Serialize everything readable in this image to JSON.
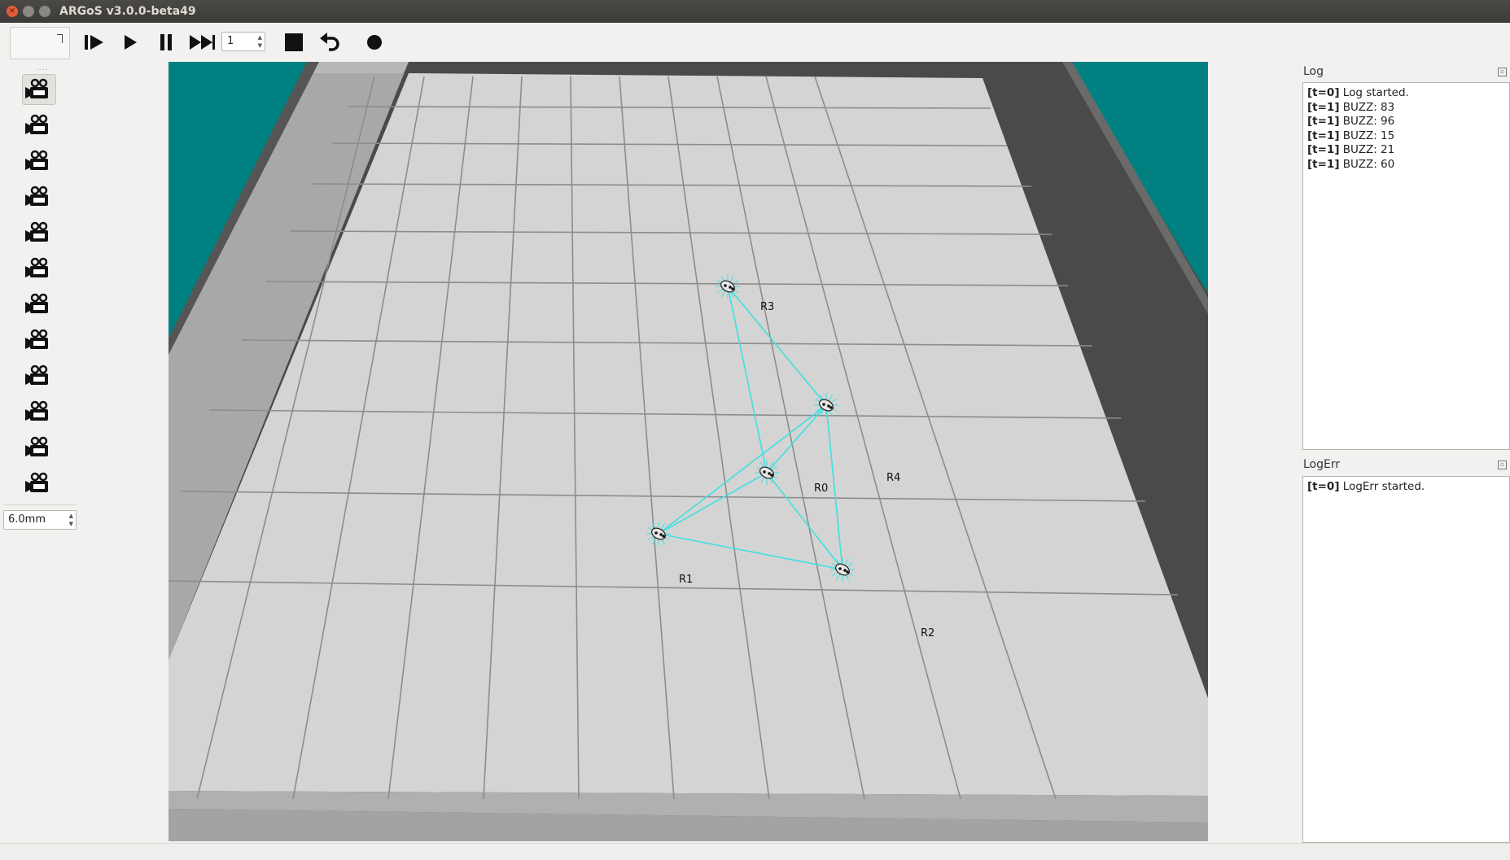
{
  "window": {
    "title": "ARGoS v3.0.0-beta49"
  },
  "toolbar": {
    "step_value": "1",
    "icons": [
      "step-icon",
      "play-icon",
      "pause-icon",
      "fast-forward-icon",
      "stop-icon",
      "reset-icon",
      "record-icon"
    ]
  },
  "left": {
    "camera_count": 12,
    "point_size": "6.0mm"
  },
  "arena": {
    "floor_color": "#d4d4d4",
    "wall_color": "#a9a9a9",
    "wall_dark_color": "#4a4a4a",
    "background_color": "#008080",
    "link_color": "#40e0e0",
    "robots": [
      {
        "label": "R0"
      },
      {
        "label": "R1"
      },
      {
        "label": "R2"
      },
      {
        "label": "R3"
      },
      {
        "label": "R4"
      }
    ]
  },
  "log": {
    "title": "Log",
    "entries": [
      {
        "tag": "[t=0]",
        "text": "Log started."
      },
      {
        "tag": "[t=1]",
        "text": "BUZZ: 83"
      },
      {
        "tag": "[t=1]",
        "text": "BUZZ: 96"
      },
      {
        "tag": "[t=1]",
        "text": "BUZZ: 15"
      },
      {
        "tag": "[t=1]",
        "text": "BUZZ: 21"
      },
      {
        "tag": "[t=1]",
        "text": "BUZZ: 60"
      }
    ]
  },
  "logerr": {
    "title": "LogErr",
    "entries": [
      {
        "tag": "[t=0]",
        "text": "LogErr started."
      }
    ]
  }
}
